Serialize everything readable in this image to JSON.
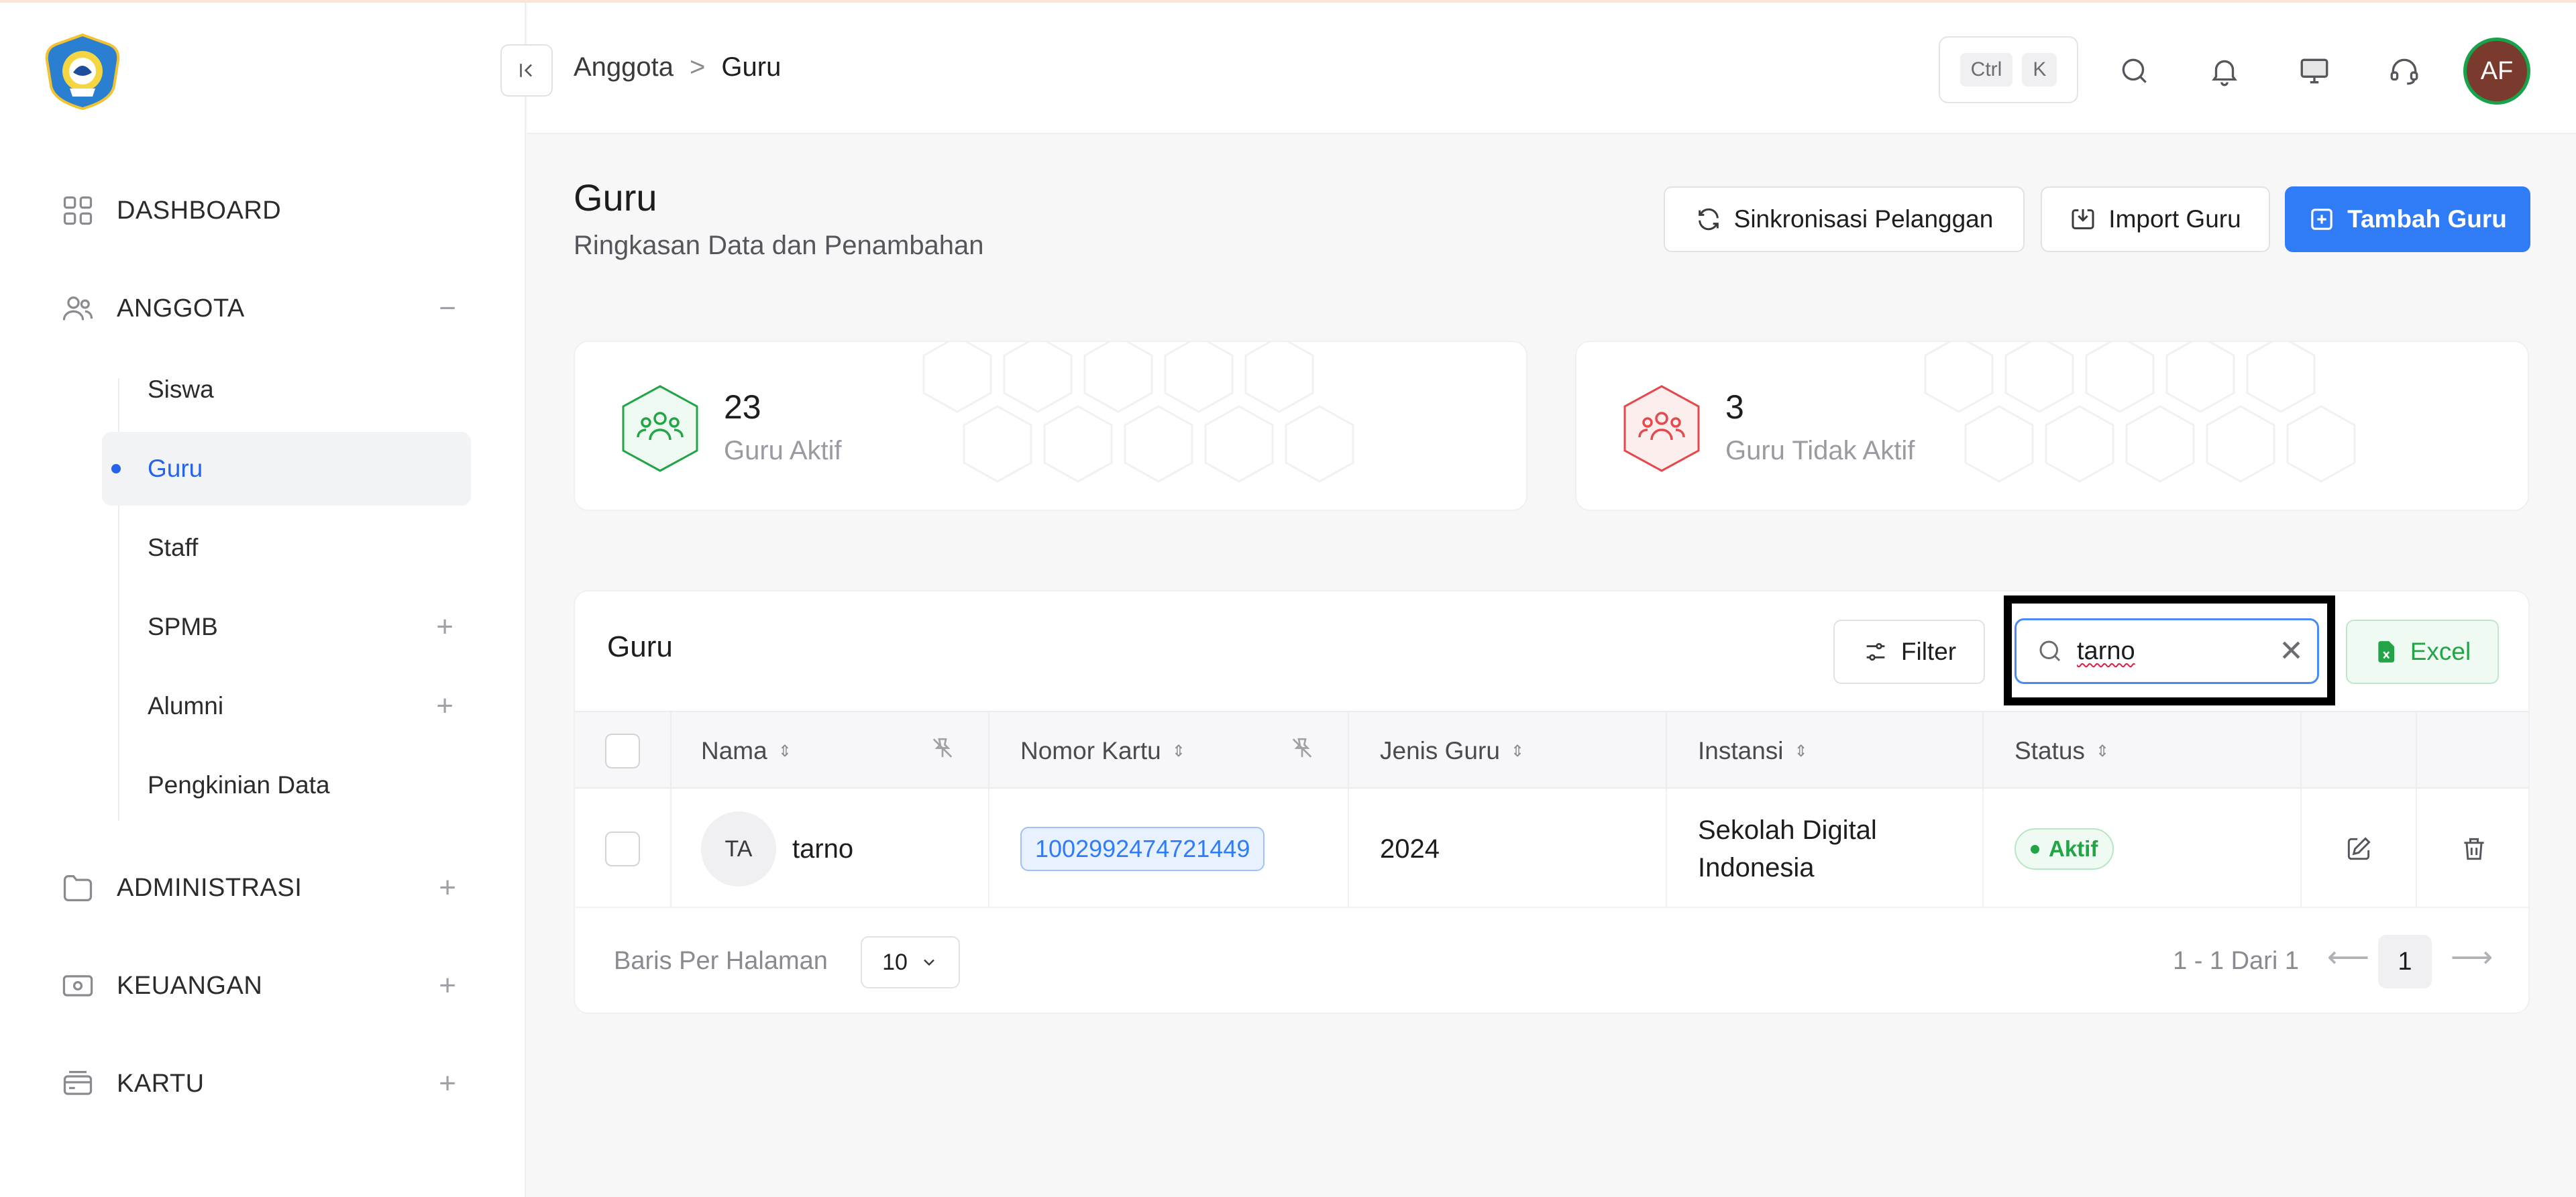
{
  "sidebar": {
    "logo_icon": "tut-wuri-handayani-logo",
    "items": [
      {
        "label": "DASHBOARD",
        "icon": "grid-icon"
      },
      {
        "label": "ANGGOTA",
        "icon": "users-icon",
        "toggle": "−"
      },
      {
        "label": "ADMINISTRASI",
        "icon": "folder-icon",
        "toggle": "+"
      },
      {
        "label": "KEUANGAN",
        "icon": "cash-icon",
        "toggle": "+"
      },
      {
        "label": "KARTU",
        "icon": "card-icon",
        "toggle": "+"
      }
    ],
    "anggota_sub": [
      {
        "label": "Siswa"
      },
      {
        "label": "Guru"
      },
      {
        "label": "Staff"
      },
      {
        "label": "SPMB",
        "toggle": "+"
      },
      {
        "label": "Alumni",
        "toggle": "+"
      },
      {
        "label": "Pengkinian Data"
      }
    ]
  },
  "header": {
    "breadcrumb": [
      "Anggota",
      "Guru"
    ],
    "breadcrumb_sep": ">",
    "shortcut": [
      "Ctrl",
      "K"
    ],
    "avatar_initials": "AF",
    "avatar_color": "#7a3a2e"
  },
  "page": {
    "title": "Guru",
    "subtitle": "Ringkasan Data dan Penambahan",
    "buttons": {
      "sync": "Sinkronisasi Pelanggan",
      "import": "Import Guru",
      "add": "Tambah Guru"
    }
  },
  "stats": [
    {
      "value": "23",
      "label": "Guru Aktif",
      "color": "#22a447"
    },
    {
      "value": "3",
      "label": "Guru Tidak Aktif",
      "color": "#e5484d"
    }
  ],
  "table": {
    "title": "Guru",
    "filter_label": "Filter",
    "search_value": "tarno",
    "excel_label": "Excel",
    "columns": [
      "Nama",
      "Nomor Kartu",
      "Jenis Guru",
      "Instansi",
      "Status"
    ],
    "rows": [
      {
        "initials": "TA",
        "nama": "tarno",
        "nomor_kartu": "1002992474721449",
        "jenis_guru": "2024",
        "instansi": "Sekolah Digital Indonesia",
        "status": "Aktif"
      }
    ],
    "rows_per_page_label": "Baris Per Halaman",
    "rows_per_page": "10",
    "page_info": "1 - 1 Dari 1",
    "current_page": "1"
  },
  "colors": {
    "primary": "#2f7cf6",
    "success": "#22a447",
    "danger": "#e5484d"
  }
}
